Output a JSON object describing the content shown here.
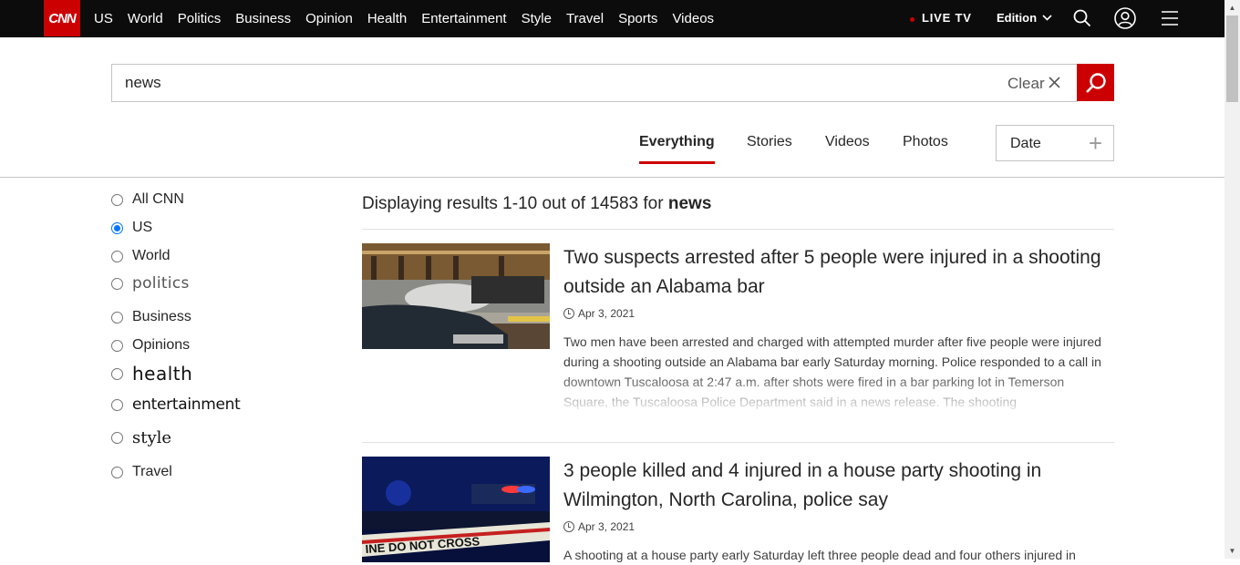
{
  "nav": {
    "logo": "CNN",
    "links": [
      "US",
      "World",
      "Politics",
      "Business",
      "Opinion",
      "Health",
      "Entertainment",
      "Style",
      "Travel",
      "Sports",
      "Videos"
    ],
    "live_tv": "LIVE TV",
    "edition": "Edition"
  },
  "search": {
    "query": "news",
    "clear_label": "Clear"
  },
  "tabs": {
    "everything": "Everything",
    "stories": "Stories",
    "videos": "Videos",
    "photos": "Photos",
    "date": "Date"
  },
  "filters": [
    {
      "label": "All CNN",
      "checked": false
    },
    {
      "label": "US",
      "checked": true
    },
    {
      "label": "World",
      "checked": false
    },
    {
      "label": "politics",
      "checked": false
    },
    {
      "label": "Business",
      "checked": false
    },
    {
      "label": "Opinions",
      "checked": false
    },
    {
      "label": "health",
      "checked": false
    },
    {
      "label": "entertainment",
      "checked": false
    },
    {
      "label": "style",
      "checked": false
    },
    {
      "label": "Travel",
      "checked": false
    }
  ],
  "results_header": {
    "prefix": "Displaying results 1-10 out of 14583 for",
    "query": "news"
  },
  "results": [
    {
      "title": "Two suspects arrested after 5 people were injured in a shooting outside an Alabama bar",
      "date": "Apr 3, 2021",
      "body": "Two men have been arrested and charged with attempted murder after five people were injured during a shooting outside an Alabama bar early Saturday morning. Police responded to a call in downtown Tuscaloosa at 2:47 a.m. after shots were fired in a bar parking lot in Temerson Square, the Tuscaloosa Police Department said in a news release. The shooting"
    },
    {
      "title": "3 people killed and 4 injured in a house party shooting in Wilmington, North Carolina, police say",
      "date": "Apr 3, 2021",
      "body": "A shooting at a house party early Saturday left three people dead and four others injured in"
    }
  ]
}
